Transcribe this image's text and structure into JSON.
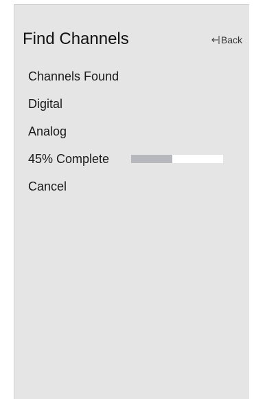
{
  "header": {
    "title": "Find Channels",
    "back_label": "Back",
    "back_icon": "back-arrow-icon"
  },
  "menu": {
    "channels_found": "Channels Found",
    "digital": "Digital",
    "analog": "Analog",
    "progress_label": "45% Complete",
    "progress_value": 0.45,
    "cancel": "Cancel"
  },
  "colors": {
    "panel_bg": "#e5e5e5",
    "progress_fill": "#b6b8bd",
    "progress_track": "#ffffff"
  }
}
